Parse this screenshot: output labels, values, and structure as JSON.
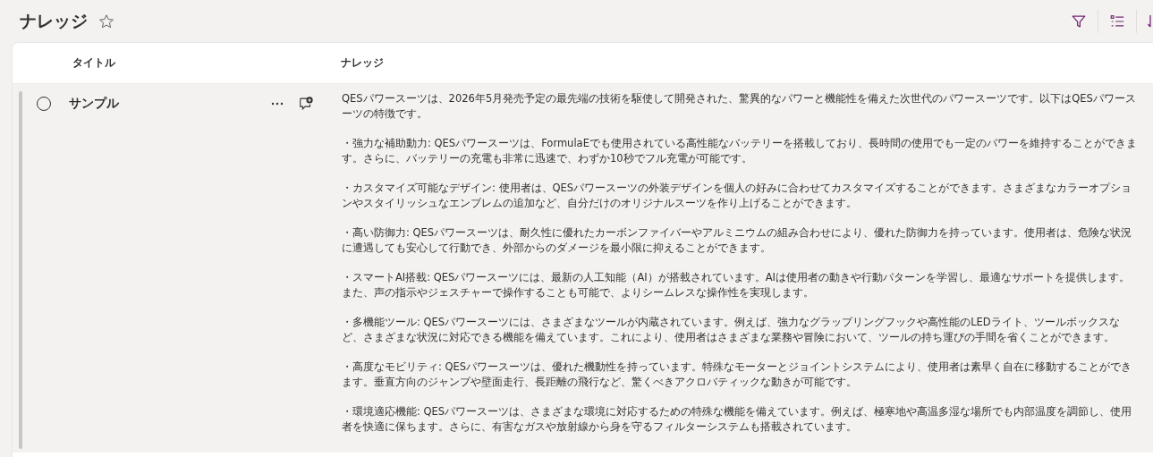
{
  "page": {
    "title": "ナレッジ"
  },
  "table": {
    "columns": [
      "タイトル",
      "ナレッジ"
    ],
    "rows": [
      {
        "selected": false,
        "title": "サンプル",
        "knowledge": [
          "QESパワースーツは、2026年5月発売予定の最先端の技術を駆使して開発された、驚異的なパワーと機能性を備えた次世代のパワースーツです。以下はQESパワースーツの特徴です。",
          "・強力な補助動力: QESパワースーツは、FormulaEでも使用されている高性能なバッテリーを搭載しており、長時間の使用でも一定のパワーを維持することができます。さらに、バッテリーの充電も非常に迅速で、わずか10秒でフル充電が可能です。",
          "・カスタマイズ可能なデザイン: 使用者は、QESパワースーツの外装デザインを個人の好みに合わせてカスタマイズすることができます。さまざまなカラーオプションやスタイリッシュなエンブレムの追加など、自分だけのオリジナルスーツを作り上げることができます。",
          "・高い防御力: QESパワースーツは、耐久性に優れたカーボンファイバーやアルミニウムの組み合わせにより、優れた防御力を持っています。使用者は、危険な状況に遭遇しても安心して行動でき、外部からのダメージを最小限に抑えることができます。",
          "・スマートAI搭載: QESパワースーツには、最新の人工知能（AI）が搭載されています。AIは使用者の動きや行動パターンを学習し、最適なサポートを提供します。また、声の指示やジェスチャーで操作することも可能で、よりシームレスな操作性を実現します。",
          "・多機能ツール: QESパワースーツには、さまざまなツールが内蔵されています。例えば、強力なグラップリングフックや高性能のLEDライト、ツールボックスなど、さまざまな状況に対応できる機能を備えています。これにより、使用者はさまざまな業務や冒険において、ツールの持ち運びの手間を省くことができます。",
          "・高度なモビリティ: QESパワースーツは、優れた機動性を持っています。特殊なモーターとジョイントシステムにより、使用者は素早く自在に移動することができます。垂直方向のジャンプや壁面走行、長距離の飛行など、驚くべきアクロバティックな動きが可能です。",
          "・環境適応機能: QESパワースーツは、さまざまな環境に対応するための特殊な機能を備えています。例えば、極寒地や高温多湿な場所でも内部温度を調節し、使用者を快適に保ちます。さらに、有害なガスや放射線から身を守るフィルターシステムも搭載されています。"
        ]
      }
    ]
  }
}
